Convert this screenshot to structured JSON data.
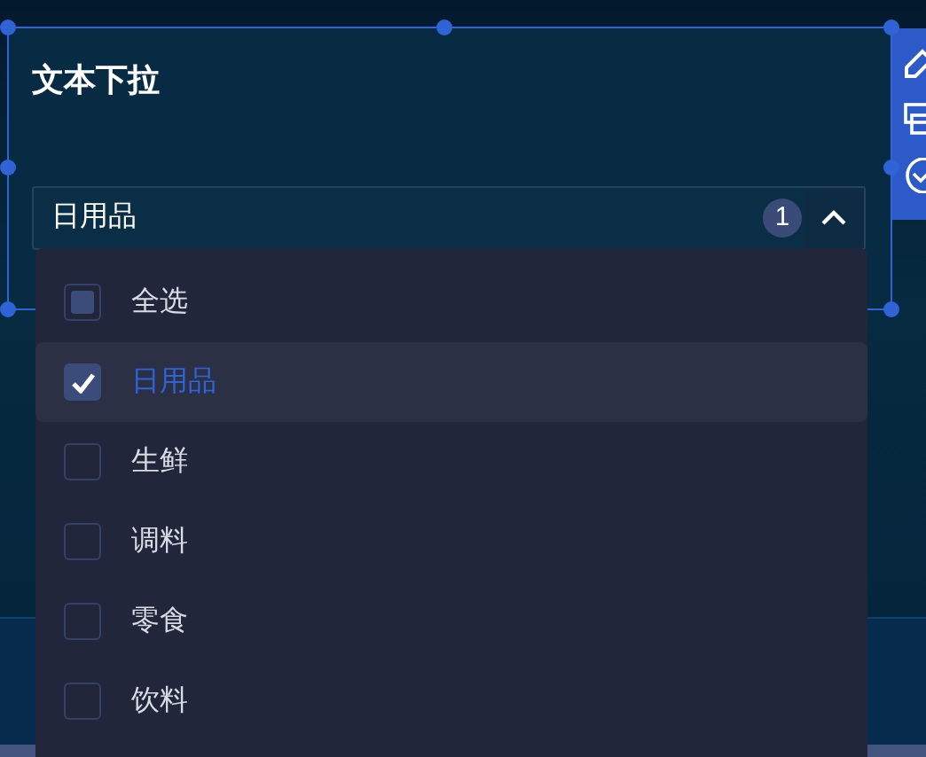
{
  "widget": {
    "title": "文本下拉",
    "selected": true
  },
  "select": {
    "value": "日用品",
    "count": "1",
    "expanded": true
  },
  "select_all": {
    "label": "全选",
    "checked": false,
    "indeterminate": true
  },
  "options": [
    {
      "label": "日用品",
      "checked": true,
      "selected": true
    },
    {
      "label": "生鲜",
      "checked": false,
      "selected": false
    },
    {
      "label": "调料",
      "checked": false,
      "selected": false
    },
    {
      "label": "零食",
      "checked": false,
      "selected": false
    },
    {
      "label": "饮料",
      "checked": false,
      "selected": false
    }
  ]
}
